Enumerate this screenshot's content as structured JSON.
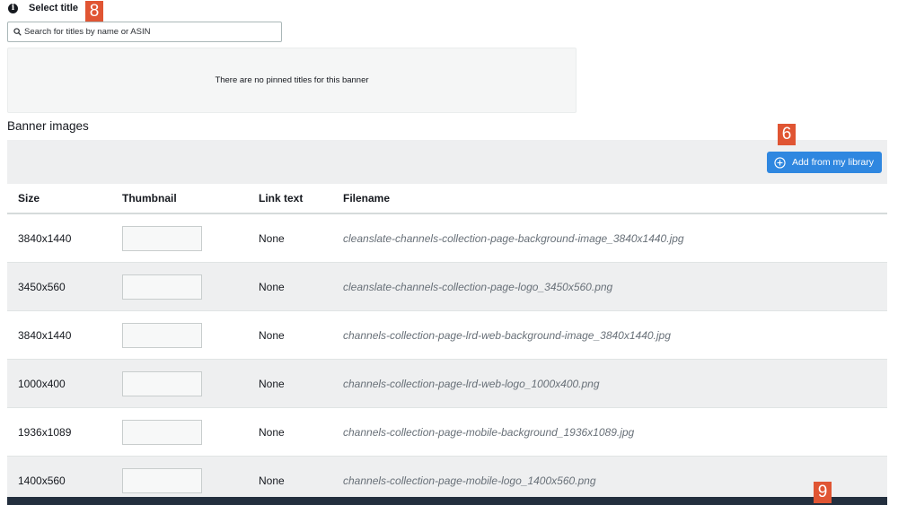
{
  "select_title": {
    "info_icon_glyph": "i",
    "label": "Select title",
    "badge": "8"
  },
  "search": {
    "placeholder": "Search for titles by name or ASIN",
    "value": ""
  },
  "pinned": {
    "empty_message": "There are no pinned titles for this banner"
  },
  "banner_images": {
    "heading": "Banner images",
    "add_button_label": "Add from my library",
    "add_badge": "6",
    "columns": {
      "size": "Size",
      "thumbnail": "Thumbnail",
      "link_text": "Link text",
      "filename": "Filename"
    },
    "rows": [
      {
        "size": "3840x1440",
        "link_text": "None",
        "filename": "cleanslate-channels-collection-page-background-image_3840x1440.jpg"
      },
      {
        "size": "3450x560",
        "link_text": "None",
        "filename": "cleanslate-channels-collection-page-logo_3450x560.png"
      },
      {
        "size": "3840x1440",
        "link_text": "None",
        "filename": "channels-collection-page-lrd-web-background-image_3840x1440.jpg"
      },
      {
        "size": "1000x400",
        "link_text": "None",
        "filename": "channels-collection-page-lrd-web-logo_1000x400.png"
      },
      {
        "size": "1936x1089",
        "link_text": "None",
        "filename": "channels-collection-page-mobile-background_1936x1089.jpg"
      },
      {
        "size": "1400x560",
        "link_text": "None",
        "filename": "channels-collection-page-mobile-logo_1400x560.png"
      }
    ]
  },
  "footer_badge": "9",
  "colors": {
    "accent": "#2f87e0",
    "badge": "#e05533",
    "toolbar_bg": "#eeeff0",
    "bottom_bar": "#232f3e"
  }
}
